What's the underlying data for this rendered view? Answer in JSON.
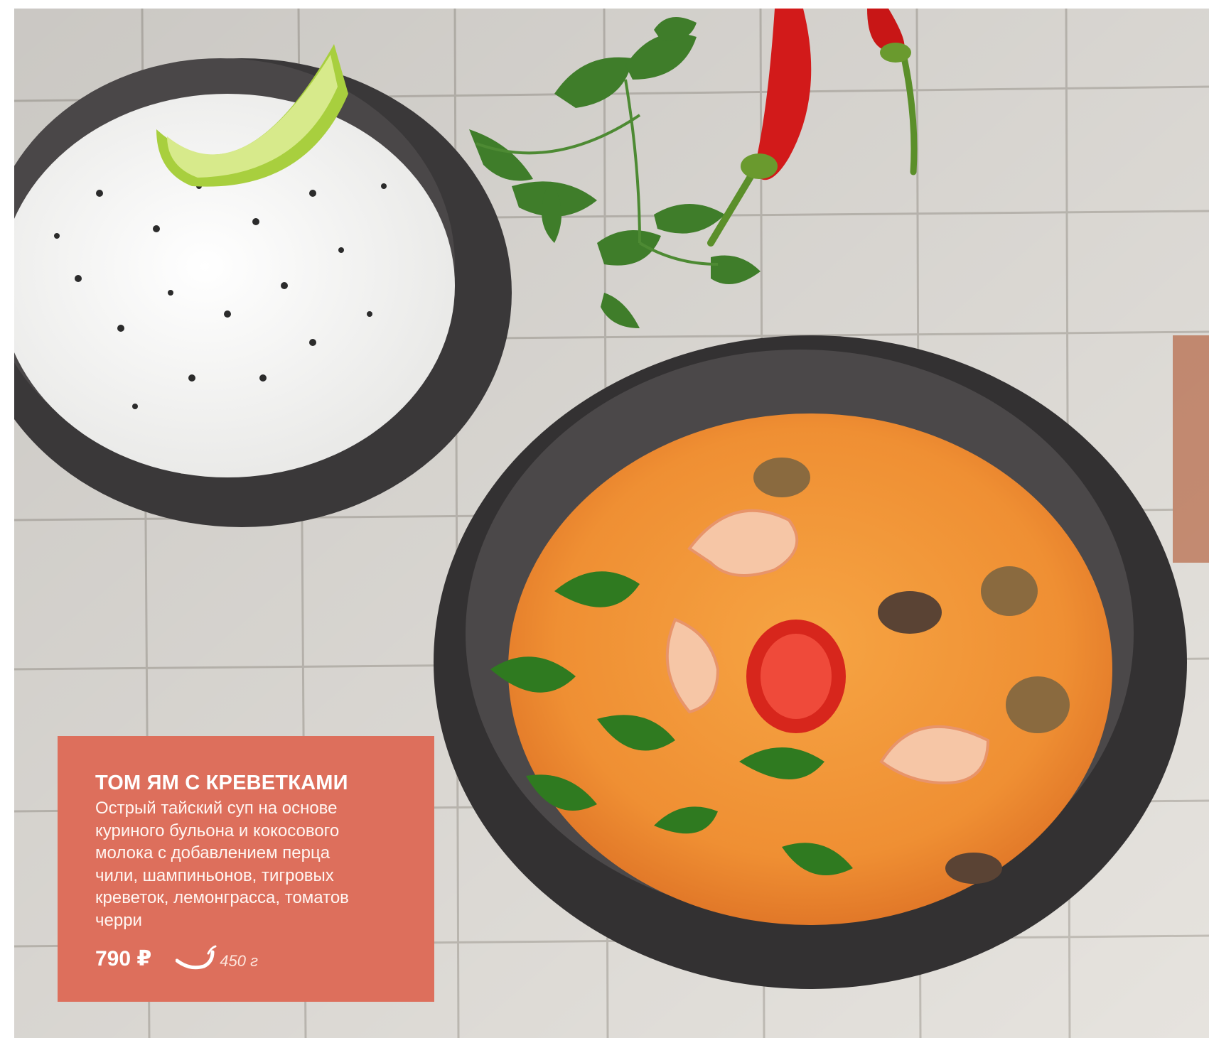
{
  "product": {
    "title": "ТОМ ЯМ С КРЕВЕТКАМИ",
    "description": "Острый тайский суп на основе\nкуриного бульона и кокосового\nмолока с добавлением перца\nчили, шампиньонов, тигровых\nкреветок, лемонграсса, томатов\nчерри",
    "price": "790 ₽",
    "weight": "450 г",
    "spicy_icon": "chili-pepper-icon"
  },
  "colors": {
    "card_background": "#dd6f5c",
    "tile_background": "#e4e1dc",
    "bowl": "#3d3b3c",
    "soup": "#f19a3a"
  }
}
